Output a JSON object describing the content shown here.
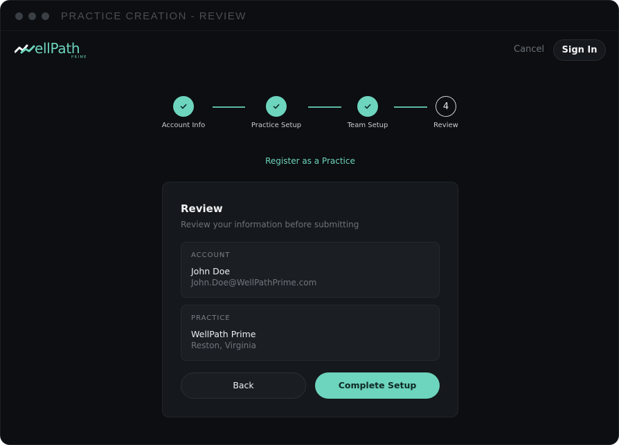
{
  "window": {
    "title": "PRACTICE CREATION - REVIEW"
  },
  "brand": {
    "name": "ellPath",
    "subtitle": "PRIME",
    "accent": "#6dd4bd"
  },
  "header": {
    "cancel_label": "Cancel",
    "signin_label": "Sign In"
  },
  "stepper": {
    "steps": [
      {
        "label": "Account Info",
        "status": "done",
        "icon": "check-icon"
      },
      {
        "label": "Practice Setup",
        "status": "done",
        "icon": "check-icon"
      },
      {
        "label": "Team Setup",
        "status": "done",
        "icon": "check-icon"
      },
      {
        "label": "Review",
        "status": "current",
        "number": "4"
      }
    ]
  },
  "register_link": "Register as a Practice",
  "card": {
    "title": "Review",
    "subtitle": "Review your information before submitting",
    "account": {
      "label": "ACCOUNT",
      "name": "John Doe",
      "email": "John.Doe@WellPathPrime.com"
    },
    "practice": {
      "label": "PRACTICE",
      "name": "WellPath Prime",
      "location": "Reston, Virginia"
    },
    "back_label": "Back",
    "complete_label": "Complete Setup"
  }
}
